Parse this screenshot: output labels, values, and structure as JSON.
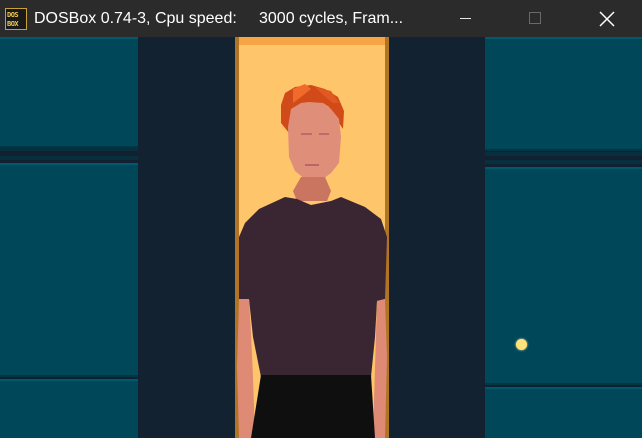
{
  "window": {
    "title": "DOSBox 0.74-3, Cpu speed:     3000 cycles, Fram...",
    "icon_text_line1": "DOS",
    "icon_text_line2": "BOX",
    "controls": [
      "minimize-icon",
      "maximize-icon",
      "close-icon"
    ]
  },
  "scene": {
    "description_icons": [
      "person-icon",
      "door-icon",
      "door-knob-icon"
    ]
  }
}
